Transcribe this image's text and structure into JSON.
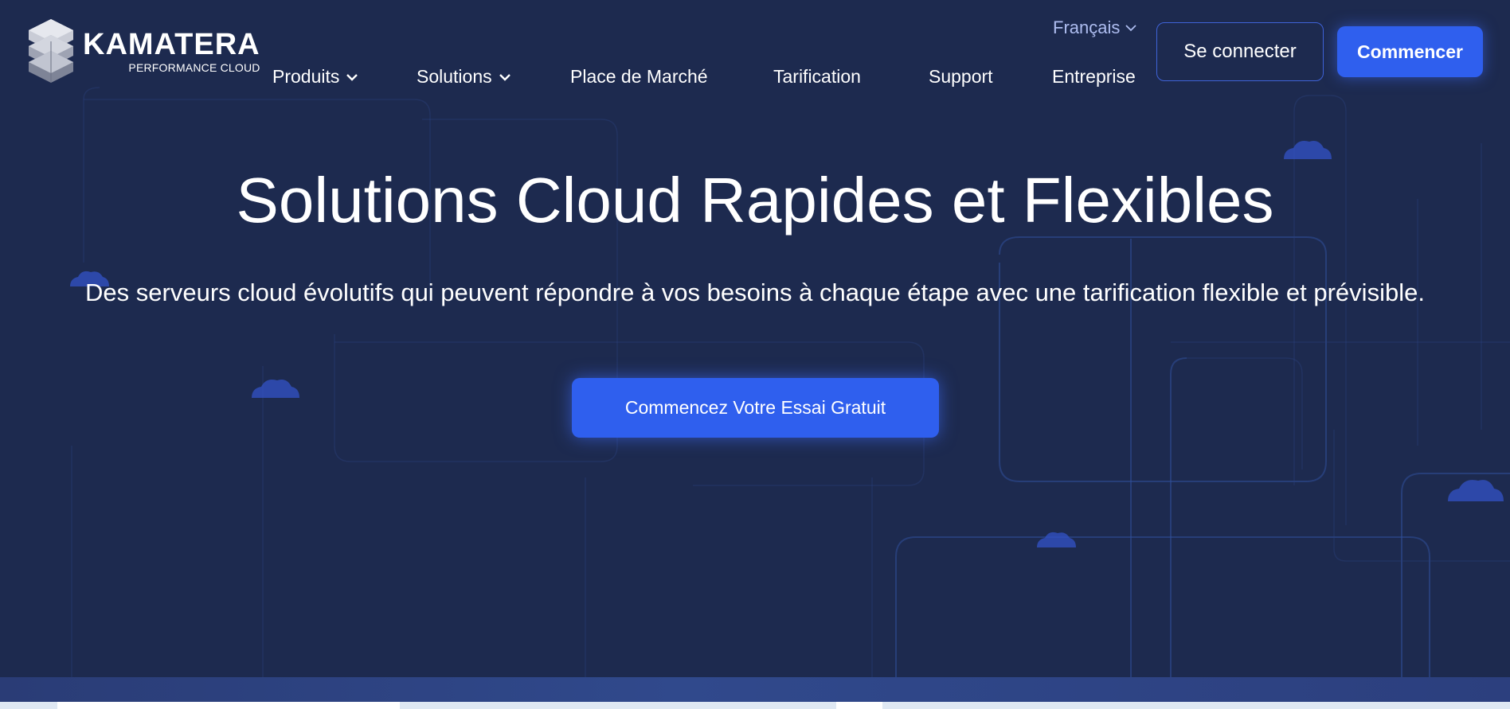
{
  "brand": {
    "name": "KAMATERA",
    "tagline": "PERFORMANCE CLOUD",
    "logo_icon": "stacked-cubes-logo"
  },
  "header": {
    "language": "Français",
    "language_icon": "chevron-down-icon",
    "nav": [
      {
        "label": "Produits",
        "has_dropdown": true
      },
      {
        "label": "Solutions",
        "has_dropdown": true
      },
      {
        "label": "Place de Marché",
        "has_dropdown": false
      },
      {
        "label": "Tarification",
        "has_dropdown": false
      },
      {
        "label": "Support",
        "has_dropdown": false
      },
      {
        "label": "Entreprise",
        "has_dropdown": false
      }
    ],
    "login_label": "Se connecter",
    "start_label": "Commencer"
  },
  "hero": {
    "title": "Solutions Cloud Rapides et Flexibles",
    "subtitle": "Des serveurs cloud évolutifs qui peuvent répondre à vos besoins à chaque étape avec une tarification flexible et prévisible.",
    "cta_label": "Commencez Votre Essai Gratuit"
  },
  "colors": {
    "background": "#1d2a4f",
    "accent": "#2f5fee",
    "language_text": "#aebdf0"
  }
}
